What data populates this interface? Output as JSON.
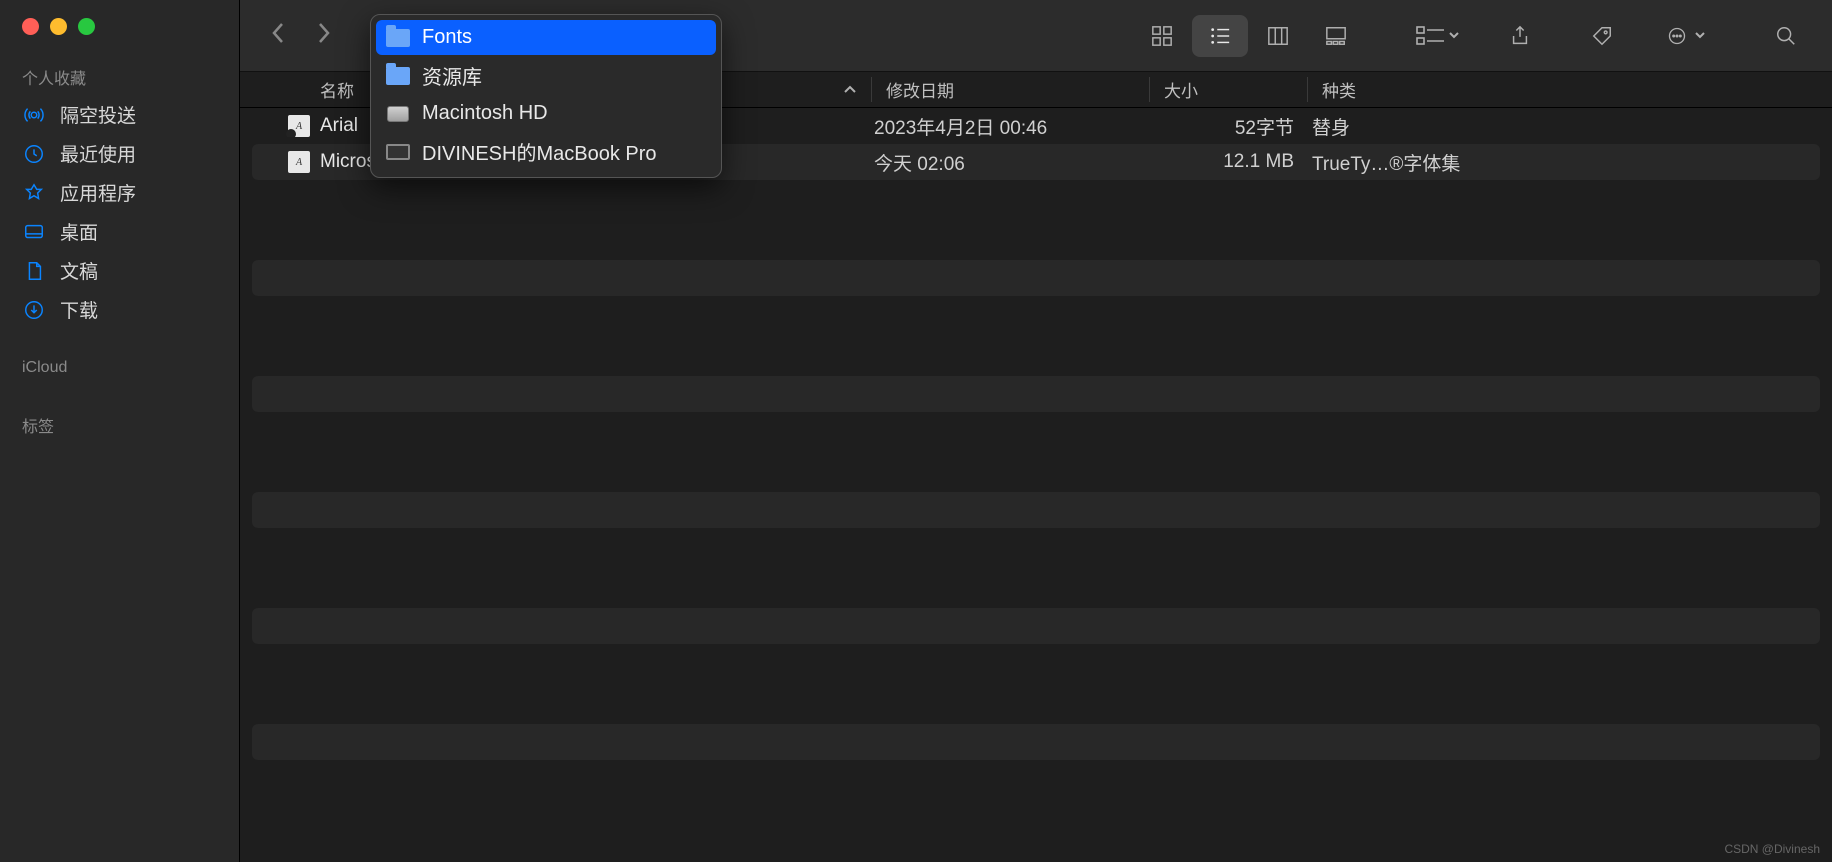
{
  "sidebar": {
    "section_favorites": "个人收藏",
    "section_icloud": "iCloud",
    "section_tags": "标签",
    "items": [
      {
        "label": "隔空投送"
      },
      {
        "label": "最近使用"
      },
      {
        "label": "应用程序"
      },
      {
        "label": "桌面"
      },
      {
        "label": "文稿"
      },
      {
        "label": "下载"
      }
    ]
  },
  "breadcrumb": {
    "items": [
      {
        "label": "Fonts",
        "type": "folder",
        "selected": true
      },
      {
        "label": "资源库",
        "type": "folder",
        "selected": false
      },
      {
        "label": "Macintosh HD",
        "type": "hd",
        "selected": false
      },
      {
        "label": "DIVINESH的MacBook Pro",
        "type": "mac",
        "selected": false
      }
    ]
  },
  "columns": {
    "name": "名称",
    "date": "修改日期",
    "size": "大小",
    "kind": "种类"
  },
  "files": [
    {
      "name": "Arial",
      "date": "2023年4月2日 00:46",
      "size": "52字节",
      "kind": "替身",
      "icon": "font-alias"
    },
    {
      "name": "Microsoft-Yahei-UI-Light.ttc",
      "date": "今天 02:06",
      "size": "12.1 MB",
      "kind": "TrueTy…®字体集",
      "icon": "font"
    }
  ],
  "watermark": "CSDN @Divinesh"
}
